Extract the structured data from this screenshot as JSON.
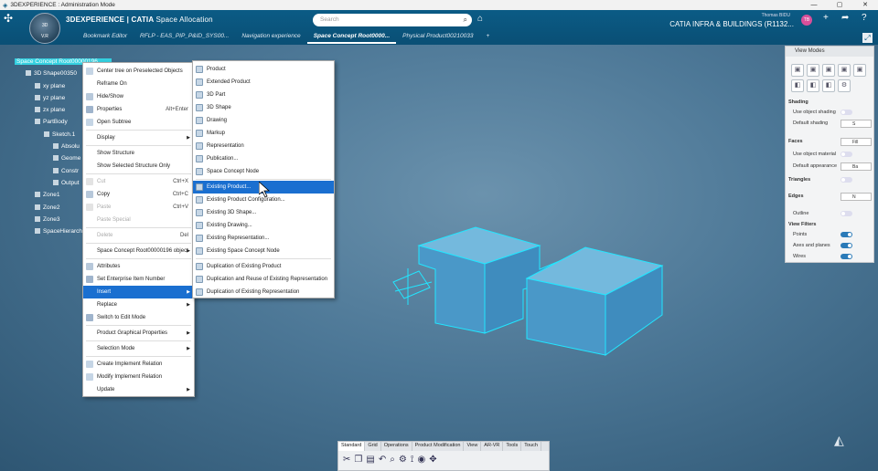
{
  "window": {
    "title": "3DEXPERIENCE : Administration Mode",
    "controls": [
      "—",
      "▢",
      "✕"
    ]
  },
  "header": {
    "compass_version": "V.R",
    "compass_top": "3D",
    "brand_bold": "3DEXPERIENCE | CATIA",
    "brand_app": "Space Allocation",
    "search_placeholder": "Search",
    "user_name": "Thomas BIDU",
    "app_title": "CATIA INFRA & BUILDINGS (R1132...",
    "avatar_initials": "TB"
  },
  "tabs": [
    {
      "label": "Bookmark Editor",
      "active": false
    },
    {
      "label": "RFLP - EAS_PIP_P&ID_SYS00...",
      "active": false
    },
    {
      "label": "Navigation experience",
      "active": false
    },
    {
      "label": "Space Concept Root0000...",
      "active": true
    },
    {
      "label": "Physical Product00210033",
      "active": false
    },
    {
      "label": "+",
      "active": false
    }
  ],
  "tree": [
    {
      "label": "Space Concept Root00000196",
      "selected": true
    },
    {
      "label": "3D Shape00350"
    },
    {
      "label": "xy plane"
    },
    {
      "label": "yz plane"
    },
    {
      "label": "zx plane"
    },
    {
      "label": "PartBody"
    },
    {
      "label": "Sketch.1"
    },
    {
      "label": "Absolu"
    },
    {
      "label": "Geome"
    },
    {
      "label": "Constr"
    },
    {
      "label": "Output"
    },
    {
      "label": "Zone1"
    },
    {
      "label": "Zone2"
    },
    {
      "label": "Zone3"
    },
    {
      "label": "SpaceHierarch"
    }
  ],
  "context_menu": {
    "items": [
      {
        "label": "Center tree on Preselected Objects",
        "shortcut": "",
        "disabled": false,
        "submenu": false
      },
      {
        "label": "Reframe On",
        "shortcut": "",
        "disabled": false,
        "submenu": false
      },
      {
        "label": "Hide/Show",
        "shortcut": "",
        "disabled": false,
        "submenu": false
      },
      {
        "label": "Properties",
        "shortcut": "Alt+Enter",
        "disabled": false,
        "submenu": false
      },
      {
        "label": "Open Subtree",
        "shortcut": "",
        "disabled": false,
        "submenu": false
      },
      {
        "label": "Display",
        "shortcut": "",
        "disabled": false,
        "submenu": true
      },
      {
        "label": "Show Structure",
        "shortcut": "",
        "disabled": false,
        "submenu": false
      },
      {
        "label": "Show Selected Structure Only",
        "shortcut": "",
        "disabled": false,
        "submenu": false
      },
      {
        "label": "Cut",
        "shortcut": "Ctrl+X",
        "disabled": true,
        "submenu": false
      },
      {
        "label": "Copy",
        "shortcut": "Ctrl+C",
        "disabled": false,
        "submenu": false
      },
      {
        "label": "Paste",
        "shortcut": "Ctrl+V",
        "disabled": true,
        "submenu": false
      },
      {
        "label": "Paste Special",
        "shortcut": "",
        "disabled": true,
        "submenu": false
      },
      {
        "label": "Delete",
        "shortcut": "Del",
        "disabled": true,
        "submenu": false
      },
      {
        "label": "Space Concept Root00000196 object",
        "shortcut": "",
        "disabled": false,
        "submenu": true
      },
      {
        "label": "Attributes",
        "shortcut": "",
        "disabled": false,
        "submenu": false
      },
      {
        "label": "Set Enterprise Item Number",
        "shortcut": "",
        "disabled": false,
        "submenu": false
      },
      {
        "label": "Insert",
        "shortcut": "",
        "disabled": false,
        "submenu": true,
        "highlighted": true
      },
      {
        "label": "Replace",
        "shortcut": "",
        "disabled": false,
        "submenu": true
      },
      {
        "label": "Switch to Edit Mode",
        "shortcut": "",
        "disabled": false,
        "submenu": false
      },
      {
        "label": "Product Graphical Properties",
        "shortcut": "",
        "disabled": false,
        "submenu": true
      },
      {
        "label": "Selection Mode",
        "shortcut": "",
        "disabled": false,
        "submenu": true
      },
      {
        "label": "Create Implement Relation",
        "shortcut": "",
        "disabled": false,
        "submenu": false
      },
      {
        "label": "Modify Implement Relation",
        "shortcut": "",
        "disabled": false,
        "submenu": false
      },
      {
        "label": "Update",
        "shortcut": "",
        "disabled": false,
        "submenu": true
      }
    ]
  },
  "insert_submenu": {
    "items": [
      {
        "label": "Product"
      },
      {
        "label": "Extended Product"
      },
      {
        "label": "3D Part"
      },
      {
        "label": "3D Shape"
      },
      {
        "label": "Drawing"
      },
      {
        "label": "Markup"
      },
      {
        "label": "Representation"
      },
      {
        "label": "Publication..."
      },
      {
        "label": "Space Concept Node"
      },
      {
        "label": "Existing Product...",
        "highlighted": true
      },
      {
        "label": "Existing Product Configuration..."
      },
      {
        "label": "Existing 3D Shape..."
      },
      {
        "label": "Existing Drawing..."
      },
      {
        "label": "Existing Representation..."
      },
      {
        "label": "Existing Space Concept Node"
      },
      {
        "label": "Duplication of Existing Product"
      },
      {
        "label": "Duplication and Reuse of Existing Representation"
      },
      {
        "label": "Duplication of Existing Representation"
      }
    ]
  },
  "view_modes": {
    "title": "View Modes",
    "shading_section": "Shading",
    "use_object_shading": "Use object shading",
    "default_shading": "Default shading",
    "default_shading_value": "S",
    "faces": "Faces",
    "faces_value": "Fill",
    "use_object_material": "Use object material",
    "default_appearance": "Default appearance",
    "default_appearance_value": "Ba",
    "triangles": "Triangles",
    "edges": "Edges",
    "edges_value": "N",
    "outline": "Outline",
    "view_filters_section": "View Filters",
    "points": "Points",
    "axes_and_planes": "Axes and planes",
    "wires": "Wires"
  },
  "action_bar": {
    "tabs": [
      "Standard",
      "Grid",
      "Operations",
      "Product Modification",
      "View",
      "AR-VR",
      "Tools",
      "Touch"
    ]
  },
  "colors": {
    "header": "#0b5b85",
    "highlight": "#1a6fd0",
    "selection": "#34d0e0",
    "model_fill": "#4f9fcf",
    "model_edge": "#22e6ff"
  }
}
